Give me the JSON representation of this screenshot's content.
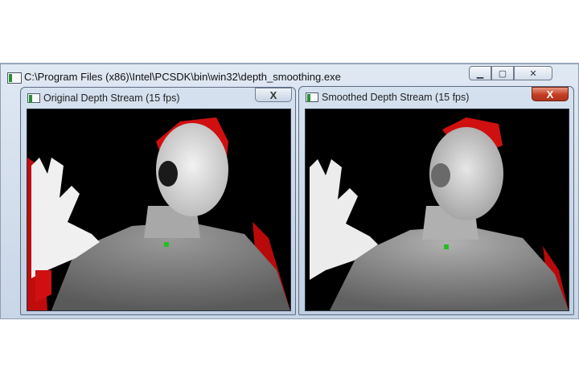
{
  "main_window": {
    "title": "C:\\Program Files (x86)\\Intel\\PCSDK\\bin\\win32\\depth_smoothing.exe",
    "icon": "console-app-icon",
    "controls": [
      "minimize-icon",
      "maximize-icon",
      "close-icon"
    ]
  },
  "windows": [
    {
      "title": "Original Depth Stream (15 fps)",
      "icon": "app-window-icon",
      "close_label": "X",
      "state": "inactive",
      "content": "raw depth image, noisy with red invalid-pixel regions"
    },
    {
      "title": "Smoothed Depth Stream (15 fps)",
      "icon": "app-window-icon",
      "close_label": "X",
      "state": "active",
      "content": "smoothed depth image with fewer red invalid regions"
    }
  ],
  "colors": {
    "invalid_pixels": "#d01010",
    "background": "#000000",
    "marker": "#22c022"
  }
}
